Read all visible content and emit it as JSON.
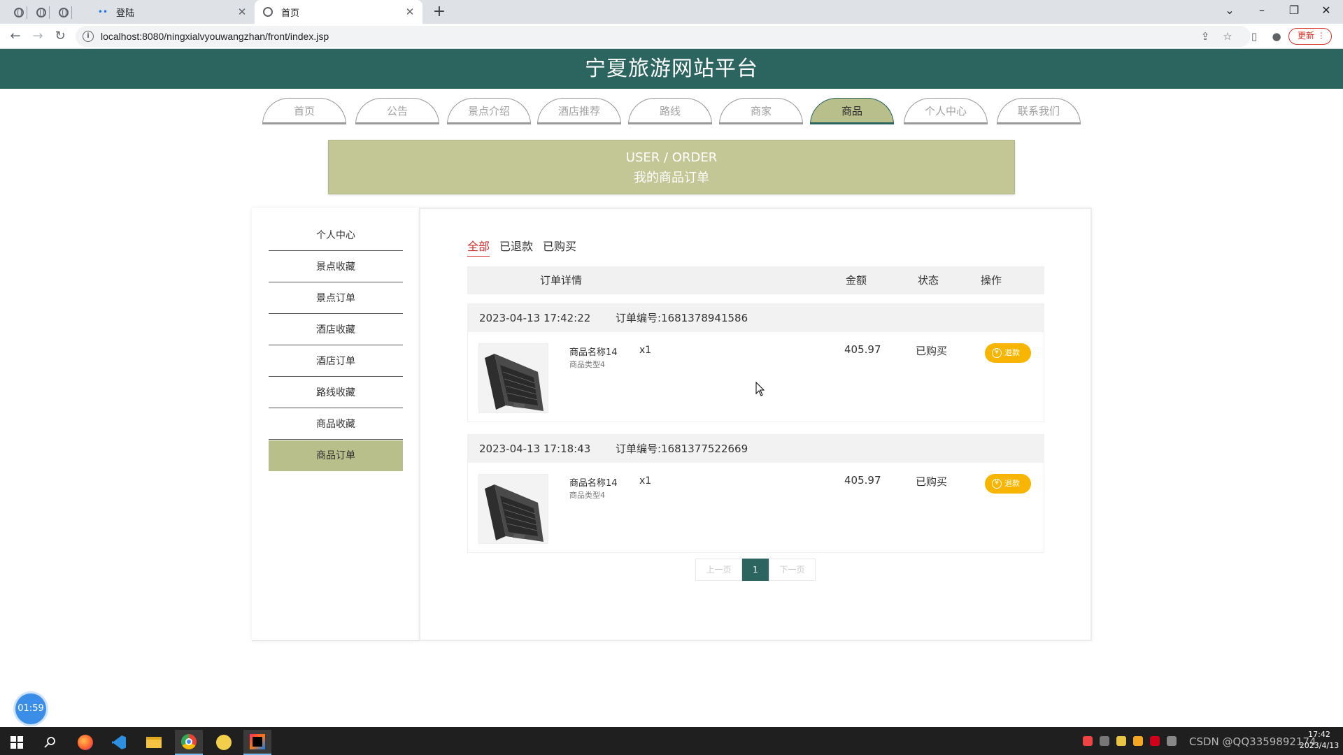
{
  "browser": {
    "tabs": [
      {
        "title": "登陆",
        "active": false
      },
      {
        "title": "首页",
        "active": true
      }
    ],
    "url": "localhost:8080/ningxialvyouwangzhan/front/index.jsp",
    "update_label": "更新"
  },
  "site": {
    "title": "宁夏旅游网站平台",
    "nav": [
      {
        "label": "首页"
      },
      {
        "label": "公告"
      },
      {
        "label": "景点介绍"
      },
      {
        "label": "酒店推荐"
      },
      {
        "label": "路线"
      },
      {
        "label": "商家"
      },
      {
        "label": "商品",
        "active": true
      },
      {
        "label": "个人中心"
      },
      {
        "label": "联系我们"
      }
    ],
    "banner": {
      "en": "USER / ORDER",
      "cn": "我的商品订单"
    }
  },
  "sidebar": {
    "items": [
      {
        "label": "个人中心"
      },
      {
        "label": "景点收藏"
      },
      {
        "label": "景点订单"
      },
      {
        "label": "酒店收藏"
      },
      {
        "label": "酒店订单"
      },
      {
        "label": "路线收藏"
      },
      {
        "label": "商品收藏"
      },
      {
        "label": "商品订单",
        "active": true
      }
    ]
  },
  "orders": {
    "filters": [
      {
        "label": "全部",
        "active": true
      },
      {
        "label": "已退款"
      },
      {
        "label": "已购买"
      }
    ],
    "columns": {
      "detail": "订单详情",
      "amount": "金额",
      "status": "状态",
      "action": "操作"
    },
    "list": [
      {
        "time": "2023-04-13 17:42:22",
        "order_no": "订单编号:1681378941586",
        "product_name": "商品名称14",
        "product_type": "商品类型4",
        "qty": "x1",
        "amount": "405.97",
        "status": "已购买",
        "action": "退款"
      },
      {
        "time": "2023-04-13 17:18:43",
        "order_no": "订单编号:1681377522669",
        "product_name": "商品名称14",
        "product_type": "商品类型4",
        "qty": "x1",
        "amount": "405.97",
        "status": "已购买",
        "action": "退款"
      }
    ],
    "pager": {
      "prev": "上一页",
      "current": "1",
      "next": "下一页"
    }
  },
  "overlay": {
    "timer": "01:59"
  },
  "taskbar": {
    "watermark": "CSDN @QQ3359892174",
    "clock_time": "17:42",
    "clock_date": "2023/4/13"
  },
  "colors": {
    "header": "#2c6460",
    "accent_olive": "#b9bf8a",
    "banner": "#c3c796",
    "refund_button": "#f7b500",
    "filter_active": "#d32f2f"
  }
}
